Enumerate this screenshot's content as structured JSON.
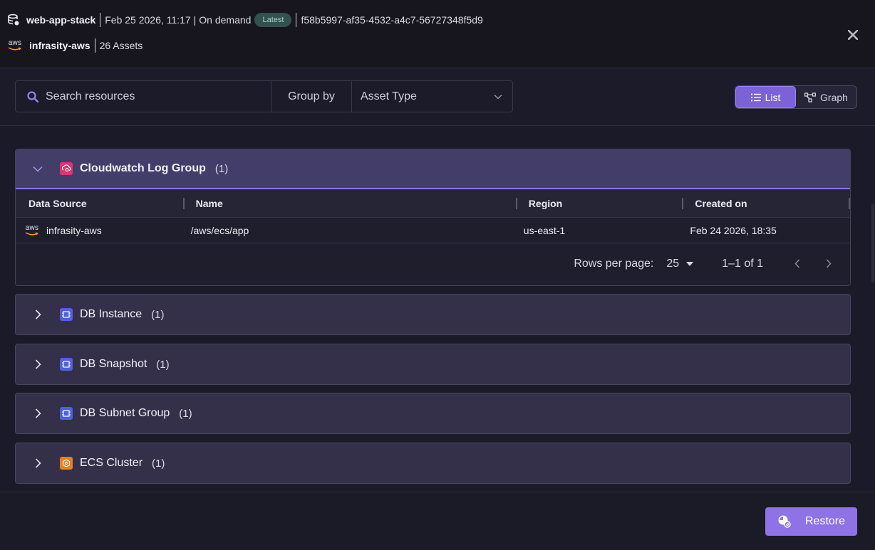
{
  "header": {
    "stack_name": "web-app-stack",
    "date_time": "Feb 25 2026, 11:17",
    "mode": "On demand",
    "badge": "Latest",
    "snapshot_id": "f58b5997-af35-4532-a4c7-56727348f5d9",
    "account_logo_text": "aws",
    "account_name": "infrasity-aws",
    "assets_count": "26 Assets"
  },
  "toolbar": {
    "search_placeholder": "Search resources",
    "group_by_label": "Group by",
    "group_by_value": "Asset Type",
    "view_list_label": "List",
    "view_graph_label": "Graph"
  },
  "expanded_group": {
    "name": "Cloudwatch Log Group",
    "count": "(1)",
    "columns": [
      "Data Source",
      "Name",
      "Region",
      "Created on"
    ],
    "rows": [
      {
        "data_source": "infrasity-aws",
        "logo_text": "aws",
        "name": "/aws/ecs/app",
        "region": "us-east-1",
        "created_on": "Feb 24 2026, 18:35"
      }
    ],
    "rows_per_page_label": "Rows per page:",
    "rows_per_page_value": "25",
    "range_text": "1–1 of 1"
  },
  "collapsed_groups": [
    {
      "name": "DB Instance",
      "count": "(1)"
    },
    {
      "name": "DB Snapshot",
      "count": "(1)"
    },
    {
      "name": "DB Subnet Group",
      "count": "(1)"
    },
    {
      "name": "ECS Cluster",
      "count": "(1)"
    }
  ],
  "footer": {
    "restore_label": "Restore"
  },
  "colors": {
    "accent": "#8f72e8",
    "cloudwatch_icon": "#e0346f",
    "db_icon": "#4f5fe8",
    "ecs_icon": "#ec7f1c"
  }
}
